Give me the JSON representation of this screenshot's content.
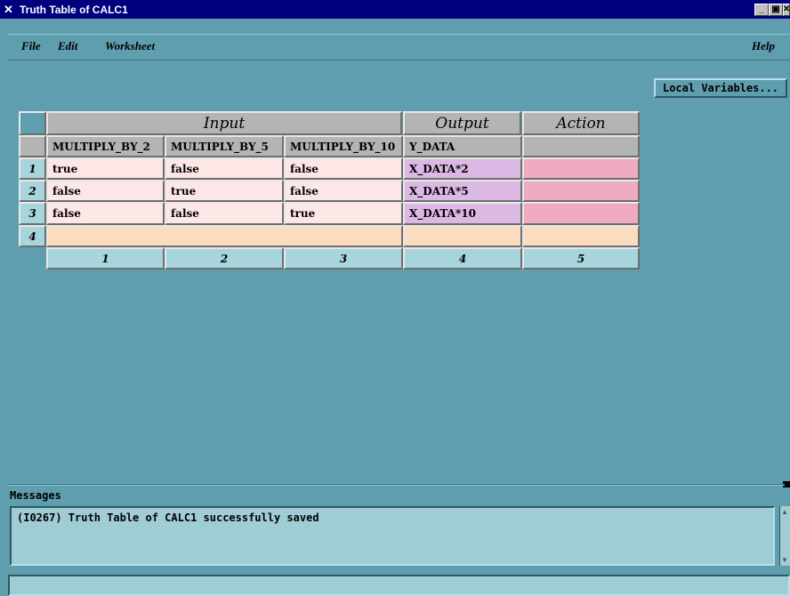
{
  "window": {
    "title": "Truth Table of CALC1"
  },
  "menu": {
    "file": "File",
    "edit": "Edit",
    "worksheet": "Worksheet",
    "help": "Help"
  },
  "buttons": {
    "local_variables": "Local Variables..."
  },
  "table": {
    "groups": {
      "input": "Input",
      "output": "Output",
      "action": "Action"
    },
    "columns": [
      "MULTIPLY_BY_2",
      "MULTIPLY_BY_5",
      "MULTIPLY_BY_10",
      "Y_DATA",
      ""
    ],
    "rows": [
      {
        "num": "1",
        "cells": [
          "true",
          "false",
          "false",
          "X_DATA*2",
          ""
        ]
      },
      {
        "num": "2",
        "cells": [
          "false",
          "true",
          "false",
          "X_DATA*5",
          ""
        ]
      },
      {
        "num": "3",
        "cells": [
          "false",
          "false",
          "true",
          "X_DATA*10",
          ""
        ]
      },
      {
        "num": "4",
        "cells": [
          "",
          "",
          "",
          "",
          ""
        ]
      }
    ],
    "column_numbers": [
      "1",
      "2",
      "3",
      "4",
      "5"
    ]
  },
  "messages": {
    "label": "Messages",
    "text": "(I0267) Truth Table of CALC1 successfully saved"
  }
}
